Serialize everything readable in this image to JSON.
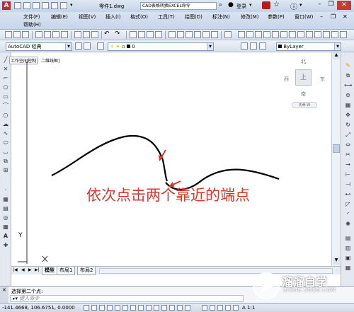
{
  "title_bar": {
    "filename": "零件1.dwg",
    "search_text": "CAD表格转换EXCEL命令",
    "login_label": "登录"
  },
  "menu": {
    "items": [
      "文件(F)",
      "编辑(E)",
      "视图(V)",
      "插入(I)",
      "格式(O)",
      "工具(T)",
      "绘图(D)",
      "标注(N)",
      "修改(M)",
      "参数(P)",
      "窗口(W)",
      "帮助(H)"
    ]
  },
  "toolbar2": {
    "workspace": "AutoCAD 经典",
    "layer_name": "0",
    "color_value": "ByLayer"
  },
  "viewport": {
    "label": "工作空间控制",
    "label_suffix": "二维线框]",
    "ucs_y": "Y"
  },
  "viewcube": {
    "north": "北",
    "south": "南",
    "east": "东",
    "west": "西",
    "face": "上",
    "wcs": "天命 W"
  },
  "annotation": {
    "text": "依次点击两个靠近的端点",
    "color": "#d63a2e"
  },
  "tabs": [
    "模型",
    "布局1",
    "布局2"
  ],
  "command": {
    "history": "选择第二个点:",
    "prompt": "键入命令"
  },
  "status": {
    "coords": "-141.4668, 106.6751, 0.0000",
    "scale": "A 1:1"
  },
  "watermark": {
    "brand": "溜溜自学",
    "url": "ZIXUE.3D66.COM"
  }
}
